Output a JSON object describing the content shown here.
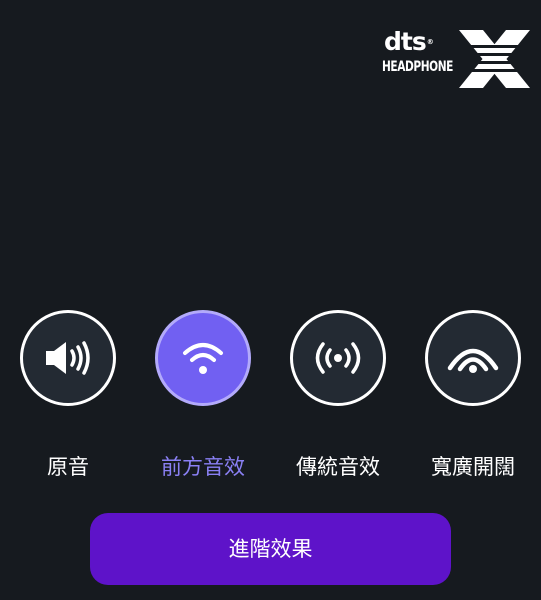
{
  "logo": {
    "brand": "dts",
    "product": "HEADPHONE",
    "suffix": "X"
  },
  "modes": [
    {
      "label": "原音",
      "icon": "speaker-volume-icon",
      "selected": false
    },
    {
      "label": "前方音效",
      "icon": "wifi-arc-icon",
      "selected": true
    },
    {
      "label": "傳統音效",
      "icon": "broadcast-icon",
      "selected": false
    },
    {
      "label": "寬廣開闊",
      "icon": "wide-arc-icon",
      "selected": false
    }
  ],
  "advanced_button": {
    "label": "進階效果"
  },
  "colors": {
    "background": "#161a1f",
    "button_background": "#232a33",
    "active_accent": "#7160f2",
    "active_label": "#8a80f4",
    "advanced_button": "#5e13c9"
  }
}
